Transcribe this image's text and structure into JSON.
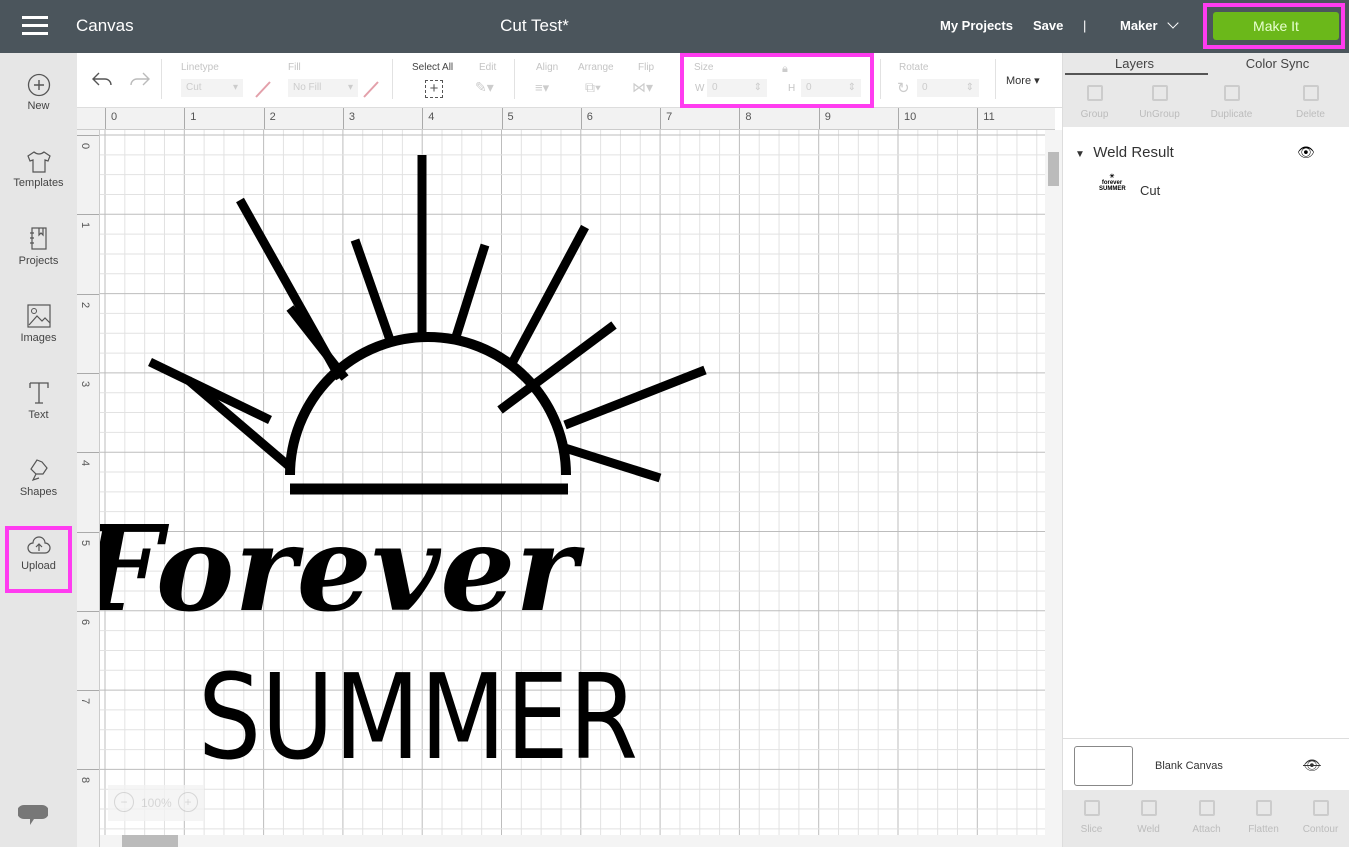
{
  "header": {
    "app_title": "Canvas",
    "doc_title": "Cut Test*",
    "my_projects": "My Projects",
    "save": "Save",
    "divider": "|",
    "machine": "Maker",
    "make_it": "Make It",
    "make_it_color": "#6bb81a",
    "highlight_color": "#ff3cf0"
  },
  "sidebar": {
    "items": [
      {
        "label": "New",
        "icon": "plus-circle-icon"
      },
      {
        "label": "Templates",
        "icon": "tshirt-icon"
      },
      {
        "label": "Projects",
        "icon": "notebook-icon"
      },
      {
        "label": "Images",
        "icon": "image-icon"
      },
      {
        "label": "Text",
        "icon": "text-icon"
      },
      {
        "label": "Shapes",
        "icon": "shapes-icon"
      },
      {
        "label": "Upload",
        "icon": "cloud-upload-icon"
      }
    ]
  },
  "toolbar": {
    "linetype_label": "Linetype",
    "linetype_value": "Cut",
    "fill_label": "Fill",
    "fill_value": "No Fill",
    "select_all": "Select All",
    "edit": "Edit",
    "align": "Align",
    "arrange": "Arrange",
    "flip": "Flip",
    "size": "Size",
    "w_label": "W",
    "w_value": "0",
    "h_label": "H",
    "h_value": "0",
    "rotate": "Rotate",
    "rotate_value": "0",
    "more": "More"
  },
  "rulers": {
    "x": [
      "0",
      "1",
      "2",
      "3",
      "4",
      "5",
      "6",
      "7",
      "8",
      "9",
      "10",
      "11"
    ],
    "y": [
      "0",
      "1",
      "2",
      "3",
      "4",
      "5",
      "6",
      "7",
      "8"
    ]
  },
  "artwork": {
    "line1": "Forever",
    "line2": "SUMMER"
  },
  "zoom": {
    "value": "100%"
  },
  "layers_panel": {
    "tabs": [
      "Layers",
      "Color Sync"
    ],
    "actions": [
      "Group",
      "UnGroup",
      "Duplicate",
      "Delete"
    ],
    "group_name": "Weld Result",
    "layer_name": "Cut",
    "blank_canvas": "Blank Canvas",
    "bottom_actions": [
      "Slice",
      "Weld",
      "Attach",
      "Flatten",
      "Contour"
    ]
  }
}
